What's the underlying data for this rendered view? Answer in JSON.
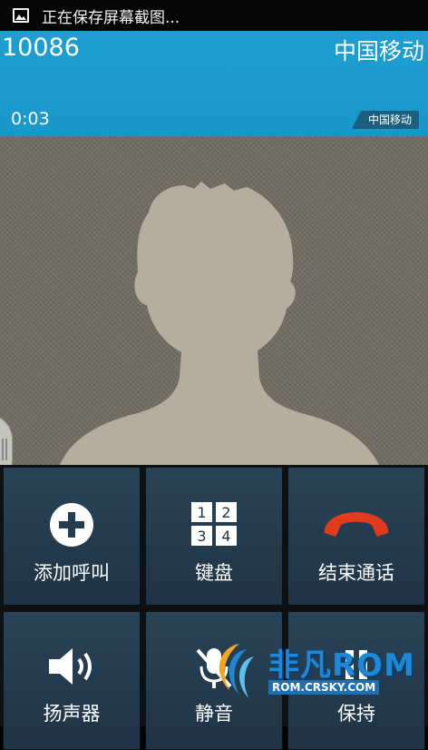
{
  "status_bar": {
    "notification_text": "正在保存屏幕截图...",
    "icon": "screenshot-image-icon"
  },
  "call": {
    "number": "10086",
    "carrier": "中国移动",
    "duration": "0:03",
    "carrier_tag": "中国移动",
    "header_color": "#1d9fd2"
  },
  "buttons": [
    {
      "label": "添加呼叫",
      "icon": "add-call-icon"
    },
    {
      "label": "键盘",
      "icon": "keypad-icon",
      "keypad_digits": [
        "1",
        "2",
        "3",
        "4"
      ]
    },
    {
      "label": "结束通话",
      "icon": "end-call-icon",
      "accent": "#e23a1c"
    },
    {
      "label": "扬声器",
      "icon": "speaker-icon"
    },
    {
      "label": "静音",
      "icon": "mute-icon"
    },
    {
      "label": "保持",
      "icon": "hold-icon"
    }
  ],
  "watermark": {
    "brand": "非凡ROM",
    "url": "ROM.CRSKY.COM"
  }
}
